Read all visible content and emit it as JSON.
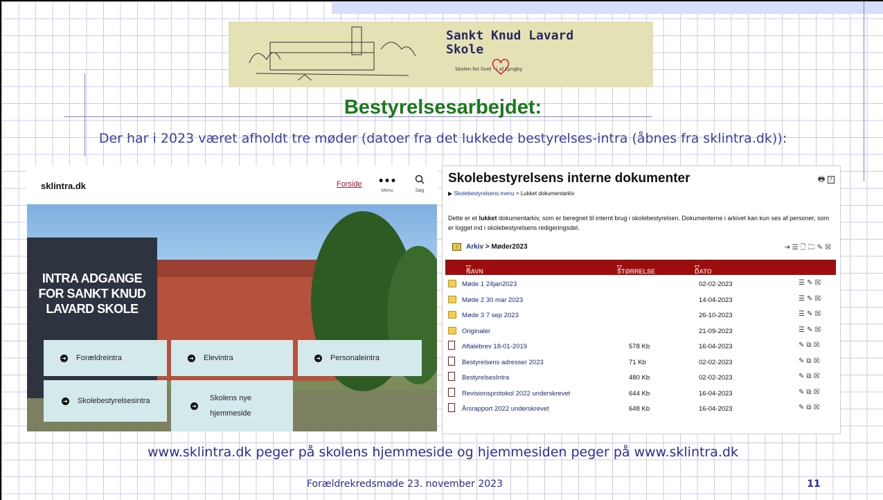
{
  "slide": {
    "logo": {
      "name_line1": "Sankt Knud Lavard",
      "name_line2": "Skole",
      "tagline": "Skolen for livet - i     af Lyngby"
    },
    "title": "Bestyrelsesarbejdet:",
    "subtitle": "Der har i 2023 været afholdt tre møder (datoer fra det lukkede bestyrelses-intra (åbnes fra sklintra.dk)):",
    "bottom_text": "www.sklintra.dk peger på skolens hjemmeside og hjemmesiden peger på www.sklintra.dk",
    "footer": "Forældrekredsmøde 23. november 2023",
    "page_number": "11"
  },
  "site": {
    "brand": "sklintra.dk",
    "nav_forside": "Forside",
    "menu_icon": "more-dots-icon",
    "menu_label": "Menu",
    "search_icon": "search-icon",
    "search_label": "Søg",
    "panel_title": "INTRA ADGANGE FOR SANKT KNUD LAVARD SKOLE",
    "tiles": [
      "Forældreintra",
      "Elevintra",
      "Personaleintra",
      "Skolebestyrelsesintra",
      "Skolens nye hjemmeside"
    ]
  },
  "archive": {
    "title": "Skolebestyrelsens interne dokumenter",
    "breadcrumb_link": "Skolebestyrelsens menu",
    "breadcrumb_current": "Lukket dokumentarkiv",
    "intro_pre": "Dette er et ",
    "intro_bold": "lukket",
    "intro_post": " dokumentarkiv, som er beregnet til internt brug i skolebestyrelsen. Dokumenterne i arkivet kan kun ses af personer, som er logget ind i skolebestyrelsens redigeringsdel.",
    "path_link": "Arkiv",
    "path_current": "Møder2023",
    "columns": {
      "name": "NAVN",
      "size": "STØRRELSE",
      "date": "DATO"
    },
    "rows": [
      {
        "type": "folder",
        "name": "Møde 1 24jan2023",
        "size": "",
        "date": "02-02-2023"
      },
      {
        "type": "folder",
        "name": "Møde 2 30 mar 2023",
        "size": "",
        "date": "14-04-2023"
      },
      {
        "type": "folder",
        "name": "Møde 3 7 sep 2023",
        "size": "",
        "date": "26-10-2023"
      },
      {
        "type": "folder",
        "name": "Originaler",
        "size": "",
        "date": "21-09-2023"
      },
      {
        "type": "pdf",
        "name": "Aftalebrev 18-01-2019",
        "size": "578 Kb",
        "date": "16-04-2023"
      },
      {
        "type": "pdf",
        "name": "Bestyrelsens adresser 2023",
        "size": "71 Kb",
        "date": "02-02-2023"
      },
      {
        "type": "pdf",
        "name": "BestyrelsesIntra",
        "size": "480 Kb",
        "date": "02-02-2023"
      },
      {
        "type": "pdf",
        "name": "Revisionsprotokol 2022 underskrevet",
        "size": "644 Kb",
        "date": "16-04-2023"
      },
      {
        "type": "pdf",
        "name": "Årsrapport 2022 underskrevet",
        "size": "648 Kb",
        "date": "16-04-2023"
      }
    ]
  }
}
